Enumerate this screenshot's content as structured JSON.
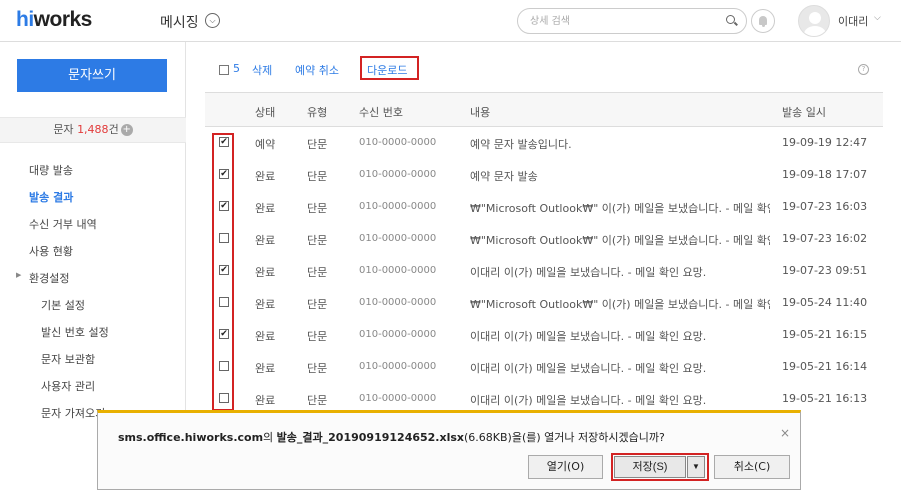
{
  "header": {
    "logo_first": "hi",
    "logo_rest": "works",
    "app_title": "메시징",
    "app_chevron": "⌵",
    "search_placeholder": "상세 검색",
    "user_name": "이대리",
    "user_chevron": "⌵"
  },
  "sidebar": {
    "compose_label": "문자쓰기",
    "count_prefix": "문자 ",
    "count_value": "1,488",
    "count_suffix": "건",
    "items": [
      {
        "label": "대량 발송"
      },
      {
        "label": "발송 결과"
      },
      {
        "label": "수신 거부 내역"
      },
      {
        "label": "사용 현황"
      },
      {
        "label": "환경설정"
      },
      {
        "label": "기본 설정"
      },
      {
        "label": "발신 번호 설정"
      },
      {
        "label": "문자 보관함"
      },
      {
        "label": "사용자 관리"
      },
      {
        "label": "문자 가져오기"
      }
    ],
    "active_item": "발송 결과"
  },
  "toolbar": {
    "count": "5",
    "delete_label": "삭제",
    "cancel_reservation_label": "예약 취소",
    "download_label": "다운로드",
    "help_label": "?"
  },
  "table": {
    "headers": [
      "상태",
      "유형",
      "수신 번호",
      "내용",
      "발송 일시"
    ],
    "rows": [
      {
        "checked": true,
        "status": "예약",
        "type": "단문",
        "phone": "010-0000-0000",
        "content": "예약 문자 발송입니다.",
        "date": "19-09-19 12:47"
      },
      {
        "checked": true,
        "status": "완료",
        "type": "단문",
        "phone": "010-0000-0000",
        "content": "예약 문자 발송",
        "date": "19-09-18 17:07"
      },
      {
        "checked": true,
        "status": "완료",
        "type": "단문",
        "phone": "010-0000-0000",
        "content": "₩\"Microsoft Outlook₩\" 이(가) 메일을 보냈습니다. - 메일 확인",
        "date": "19-07-23 16:03"
      },
      {
        "checked": false,
        "status": "완료",
        "type": "단문",
        "phone": "010-0000-0000",
        "content": "₩\"Microsoft Outlook₩\" 이(가) 메일을 보냈습니다. - 메일 확인",
        "date": "19-07-23 16:02"
      },
      {
        "checked": true,
        "status": "완료",
        "type": "단문",
        "phone": "010-0000-0000",
        "content": "이대리 이(가) 메일을 보냈습니다. - 메일 확인 요망.",
        "date": "19-07-23 09:51"
      },
      {
        "checked": false,
        "status": "완료",
        "type": "단문",
        "phone": "010-0000-0000",
        "content": "₩\"Microsoft Outlook₩\" 이(가) 메일을 보냈습니다. - 메일 확인",
        "date": "19-05-24 11:40"
      },
      {
        "checked": true,
        "status": "완료",
        "type": "단문",
        "phone": "010-0000-0000",
        "content": "이대리 이(가) 메일을 보냈습니다. - 메일 확인 요망.",
        "date": "19-05-21 16:15"
      },
      {
        "checked": false,
        "status": "완료",
        "type": "단문",
        "phone": "010-0000-0000",
        "content": "이대리 이(가) 메일을 보냈습니다. - 메일 확인 요망.",
        "date": "19-05-21 16:14"
      },
      {
        "checked": false,
        "status": "완료",
        "type": "단문",
        "phone": "010-0000-0000",
        "content": "이대리 이(가) 메일을 보냈습니다. - 메일 확인 요망.",
        "date": "19-05-21 16:13"
      }
    ]
  },
  "download_bar": {
    "domain": "sms.office.hiworks.com",
    "text_1": "의 ",
    "filename": "발송_결과_20190919124652.xlsx",
    "size": "(6.68KB)",
    "text_2": "을(를) 열거나 저장하시겠습니까?",
    "open_label": "열기(O)",
    "save_label": "저장(S)",
    "save_arrow": "▼",
    "cancel_label": "취소(C)",
    "close_label": "×"
  },
  "colors": {
    "accent": "#2d7be5",
    "count_red": "#e23b3b",
    "highlight_red": "#d32323",
    "download_bar_border": "#e8b000"
  },
  "icons": [
    "search-icon",
    "bell-icon",
    "avatar",
    "plus-icon",
    "caret-right-icon",
    "help-icon",
    "close-icon",
    "chevron-down-icon"
  ]
}
